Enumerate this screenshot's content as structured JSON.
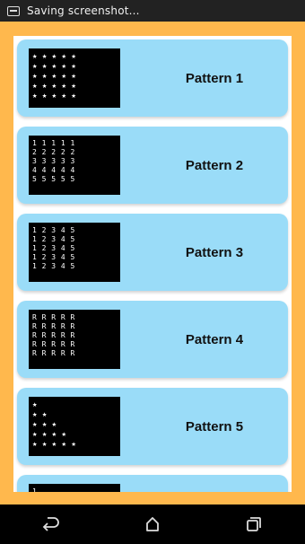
{
  "status_bar": {
    "notification_text": "Saving screenshot..."
  },
  "cards": [
    {
      "title": "Pattern 1",
      "preview": [
        "★ ★ ★ ★ ★",
        "★ ★ ★ ★ ★",
        "★ ★ ★ ★ ★",
        "★ ★ ★ ★ ★",
        "★ ★ ★ ★ ★"
      ]
    },
    {
      "title": "Pattern 2",
      "preview": [
        "1 1 1 1 1",
        "2 2 2 2 2",
        "3 3 3 3 3",
        "4 4 4 4 4",
        "5 5 5 5 5"
      ]
    },
    {
      "title": "Pattern 3",
      "preview": [
        "1 2 3 4 5",
        "1 2 3 4 5",
        "1 2 3 4 5",
        "1 2 3 4 5",
        "1 2 3 4 5"
      ]
    },
    {
      "title": "Pattern 4",
      "preview": [
        "R R R R R",
        "R R R R R",
        "R R R R R",
        "R R R R R",
        "R R R R R"
      ]
    },
    {
      "title": "Pattern 5",
      "preview": [
        "★",
        "★ ★",
        "★ ★ ★",
        "★ ★ ★ ★",
        "★ ★ ★ ★ ★"
      ]
    },
    {
      "title": "",
      "preview": [
        "1"
      ]
    }
  ],
  "nav_bar": {
    "icons": [
      "back-icon",
      "home-icon",
      "recents-icon"
    ]
  }
}
